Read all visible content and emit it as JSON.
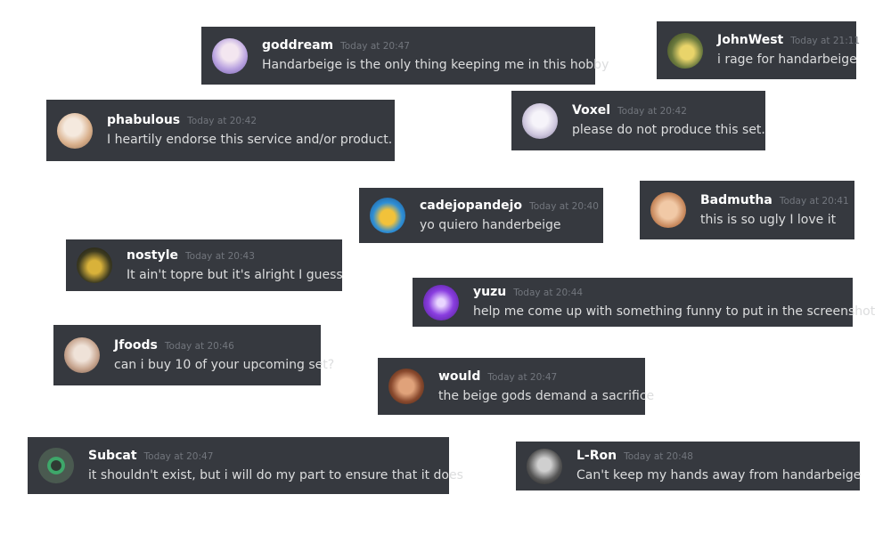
{
  "messages": [
    {
      "name": "goddream",
      "timestamp": "Today at 20:47",
      "text": "Handarbeige is the only thing keeping me in this hobby",
      "avatar_color": "#b9a2e0"
    },
    {
      "name": "JohnWest",
      "timestamp": "Today at 21:11",
      "text": "i rage for handarbeige",
      "avatar_color": "#6b7a3e"
    },
    {
      "name": "phabulous",
      "timestamp": "Today at 20:42",
      "text": "I heartily endorse this service and/or product.",
      "avatar_color": "#e9d3c4"
    },
    {
      "name": "Voxel",
      "timestamp": "Today at 20:42",
      "text": "please do not produce this set.",
      "avatar_color": "#d9d4e6"
    },
    {
      "name": "cadejopandejo",
      "timestamp": "Today at 20:40",
      "text": "yo quiero handerbeige",
      "avatar_color": "#2e8fd6"
    },
    {
      "name": "Badmutha",
      "timestamp": "Today at 20:41",
      "text": "this is so ugly I love it",
      "avatar_color": "#c98a5e"
    },
    {
      "name": "nostyle",
      "timestamp": "Today at 20:43",
      "text": "It ain't topre but it's alright I guess",
      "avatar_color": "#3c3a20"
    },
    {
      "name": "yuzu",
      "timestamp": "Today at 20:44",
      "text": "help me come up with something funny to put in the screenshot",
      "avatar_color": "#8a3ee0"
    },
    {
      "name": "Jfoods",
      "timestamp": "Today at 20:46",
      "text": "can i buy 10 of your upcoming set?",
      "avatar_color": "#c7a58f"
    },
    {
      "name": "would",
      "timestamp": "Today at 20:47",
      "text": "the beige gods demand a sacrifice",
      "avatar_color": "#8a4a2e"
    },
    {
      "name": "Subcat",
      "timestamp": "Today at 20:47",
      "text": "it shouldn't exist, but i will do my part to ensure that it does",
      "avatar_color": "#4a5a50"
    },
    {
      "name": "L-Ron",
      "timestamp": "Today at 20:48",
      "text": "Can't keep my hands away from handarbeige",
      "avatar_color": "#555555"
    }
  ]
}
